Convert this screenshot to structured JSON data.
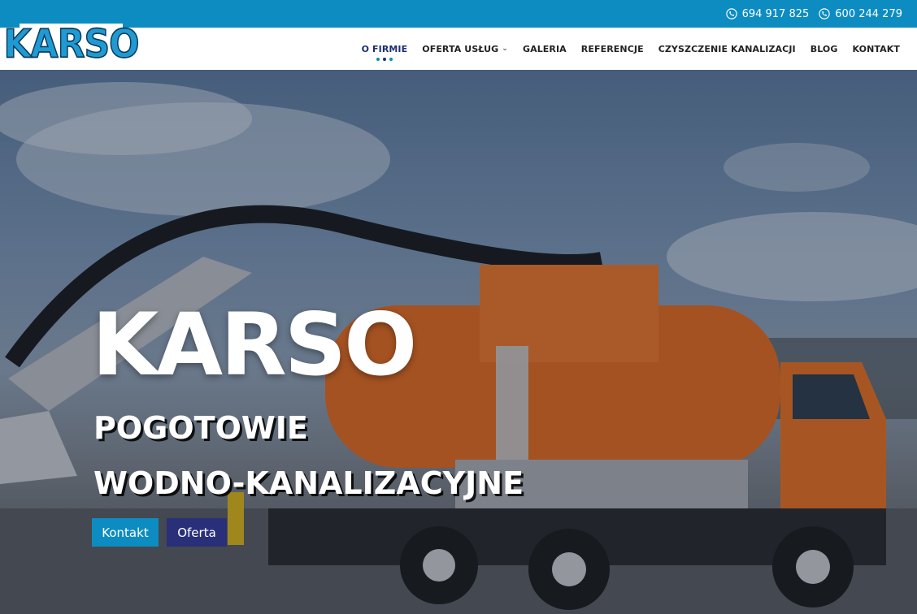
{
  "topbar": {
    "phones": [
      "694 917 825",
      "600 244 279"
    ],
    "icon": "phone-icon",
    "background": "#0d8cc1"
  },
  "header": {
    "logo_text": "KARSO",
    "nav": [
      {
        "label": "O FIRMIE",
        "active": true
      },
      {
        "label": "OFERTA USŁUG",
        "dropdown": true
      },
      {
        "label": "GALERIA"
      },
      {
        "label": "REFERENCJE"
      },
      {
        "label": "CZYSZCZENIE KANALIZACJI"
      },
      {
        "label": "BLOG"
      },
      {
        "label": "KONTAKT"
      }
    ]
  },
  "hero": {
    "title": "KARSO",
    "subtitle_line1": "POGOTOWIE",
    "subtitle_line2": "WODNO-KANALIZACYJNE",
    "buttons": [
      {
        "label": "Kontakt",
        "color": "#0d8cc1"
      },
      {
        "label": "Oferta",
        "color": "#2a2f7a"
      }
    ],
    "image": "sewer-cleaning-truck-photo"
  }
}
